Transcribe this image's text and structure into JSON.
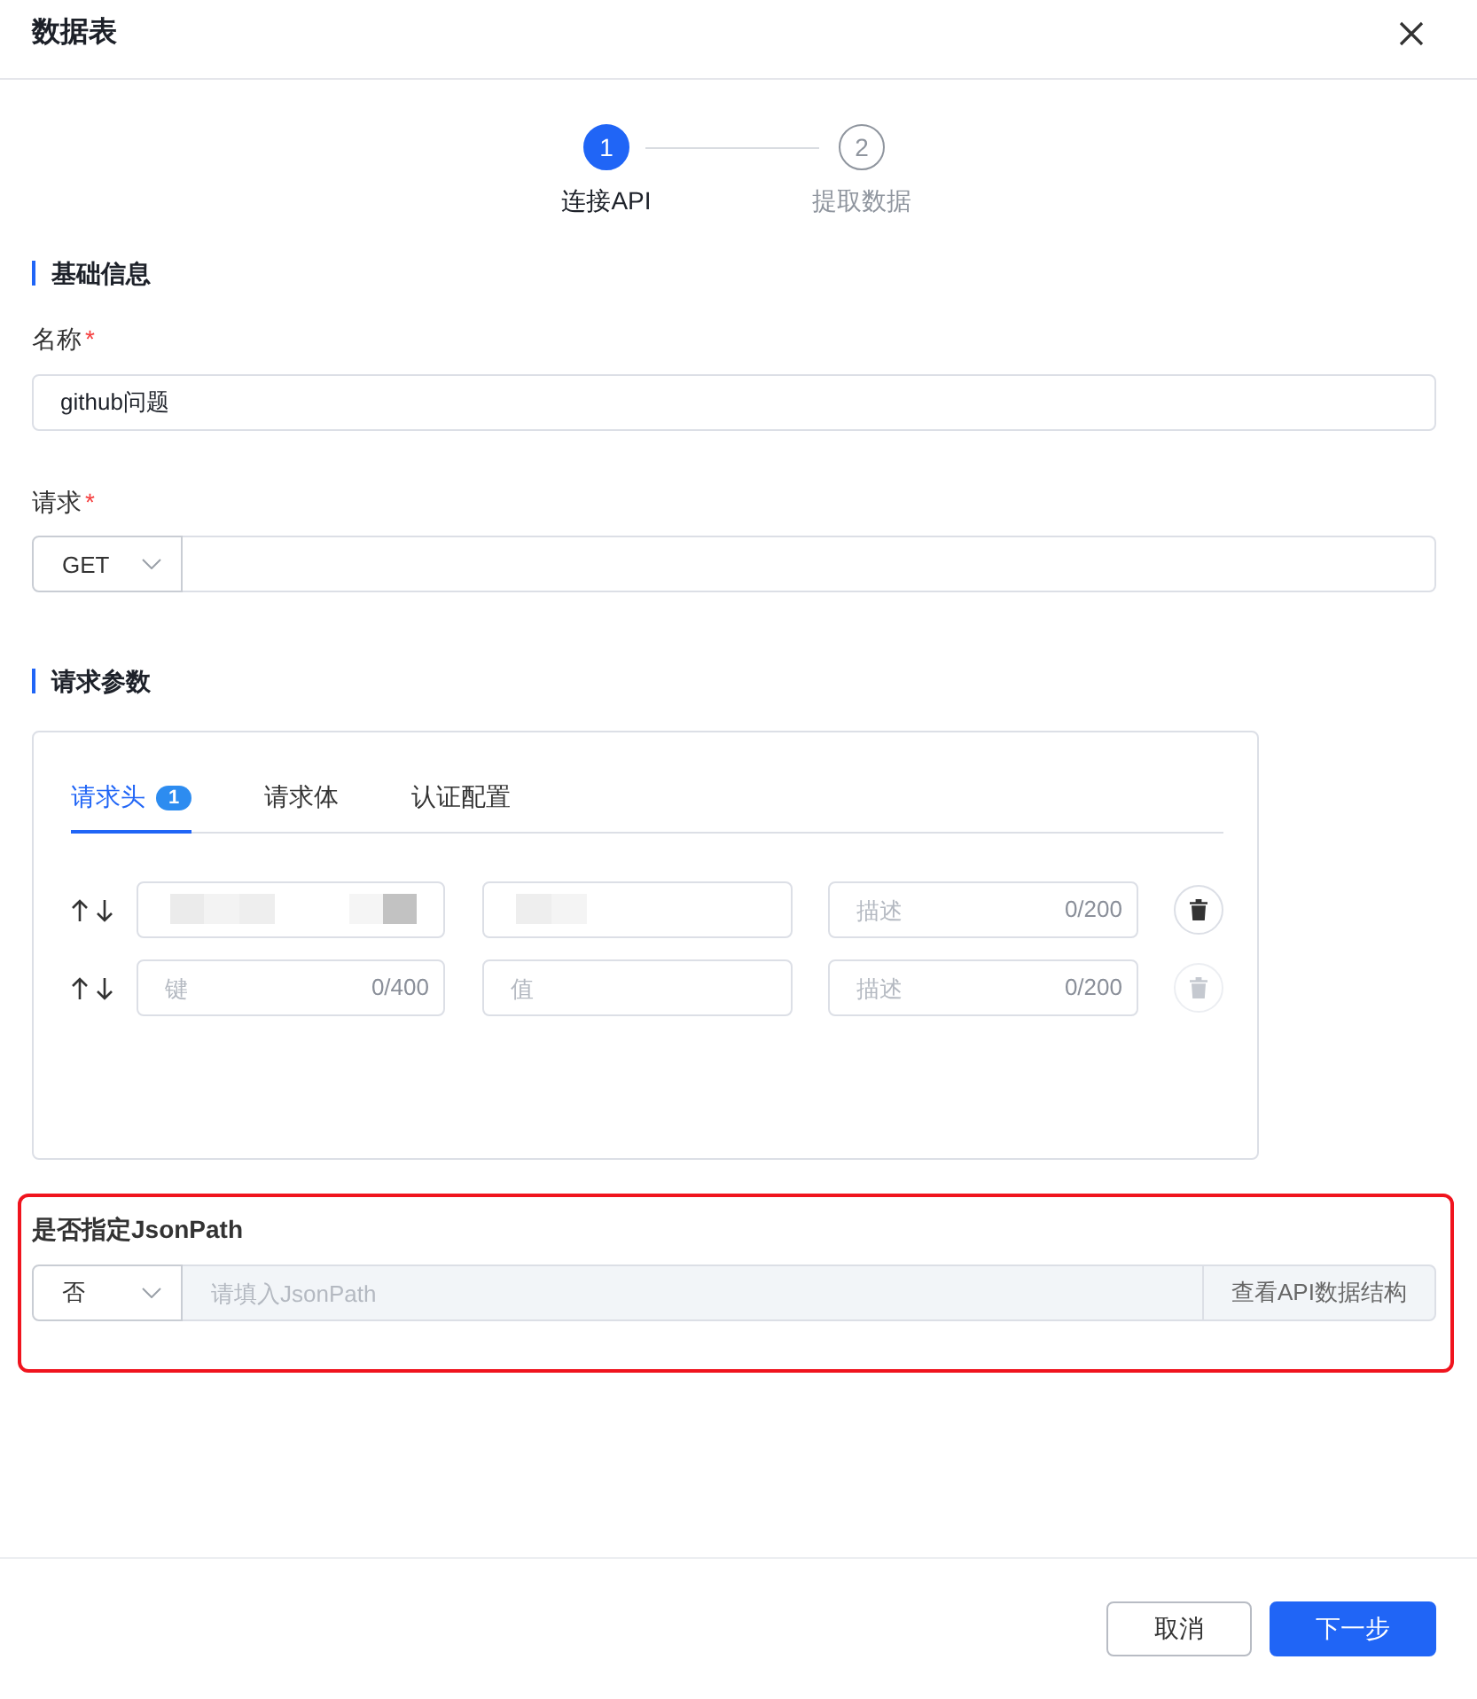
{
  "dialog": {
    "title": "数据表"
  },
  "steps": [
    {
      "number": "1",
      "label": "连接API",
      "selected": true
    },
    {
      "number": "2",
      "label": "提取数据",
      "selected": false
    }
  ],
  "basic_info": {
    "title": "基础信息",
    "name_field": {
      "label": "名称",
      "required_mark": "*",
      "value": "github问题"
    },
    "request_field": {
      "label": "请求",
      "required_mark": "*",
      "method": "GET"
    }
  },
  "request_params": {
    "title": "请求参数",
    "tabs": [
      {
        "label": "请求头",
        "badge": "1",
        "selected": true
      },
      {
        "label": "请求体",
        "selected": false
      },
      {
        "label": "认证配置",
        "selected": false
      }
    ],
    "header_rows": [
      {
        "redacted": true,
        "description": {
          "placeholder": "描述",
          "counter": "0/200"
        },
        "delete_disabled": false
      },
      {
        "redacted": false,
        "key": {
          "placeholder": "键",
          "counter": "0/400"
        },
        "value": {
          "placeholder": "值"
        },
        "description": {
          "placeholder": "描述",
          "counter": "0/200"
        },
        "delete_disabled": true
      }
    ]
  },
  "jsonpath": {
    "label": "是否指定JsonPath",
    "highlighted": true,
    "mode": "否",
    "placeholder": "请填入JsonPath",
    "disabled": true,
    "button": "查看API数据结构"
  },
  "footer": {
    "buttons": [
      {
        "label": "取消",
        "kind": "secondary"
      },
      {
        "label": "下一步",
        "kind": "primary"
      }
    ]
  }
}
